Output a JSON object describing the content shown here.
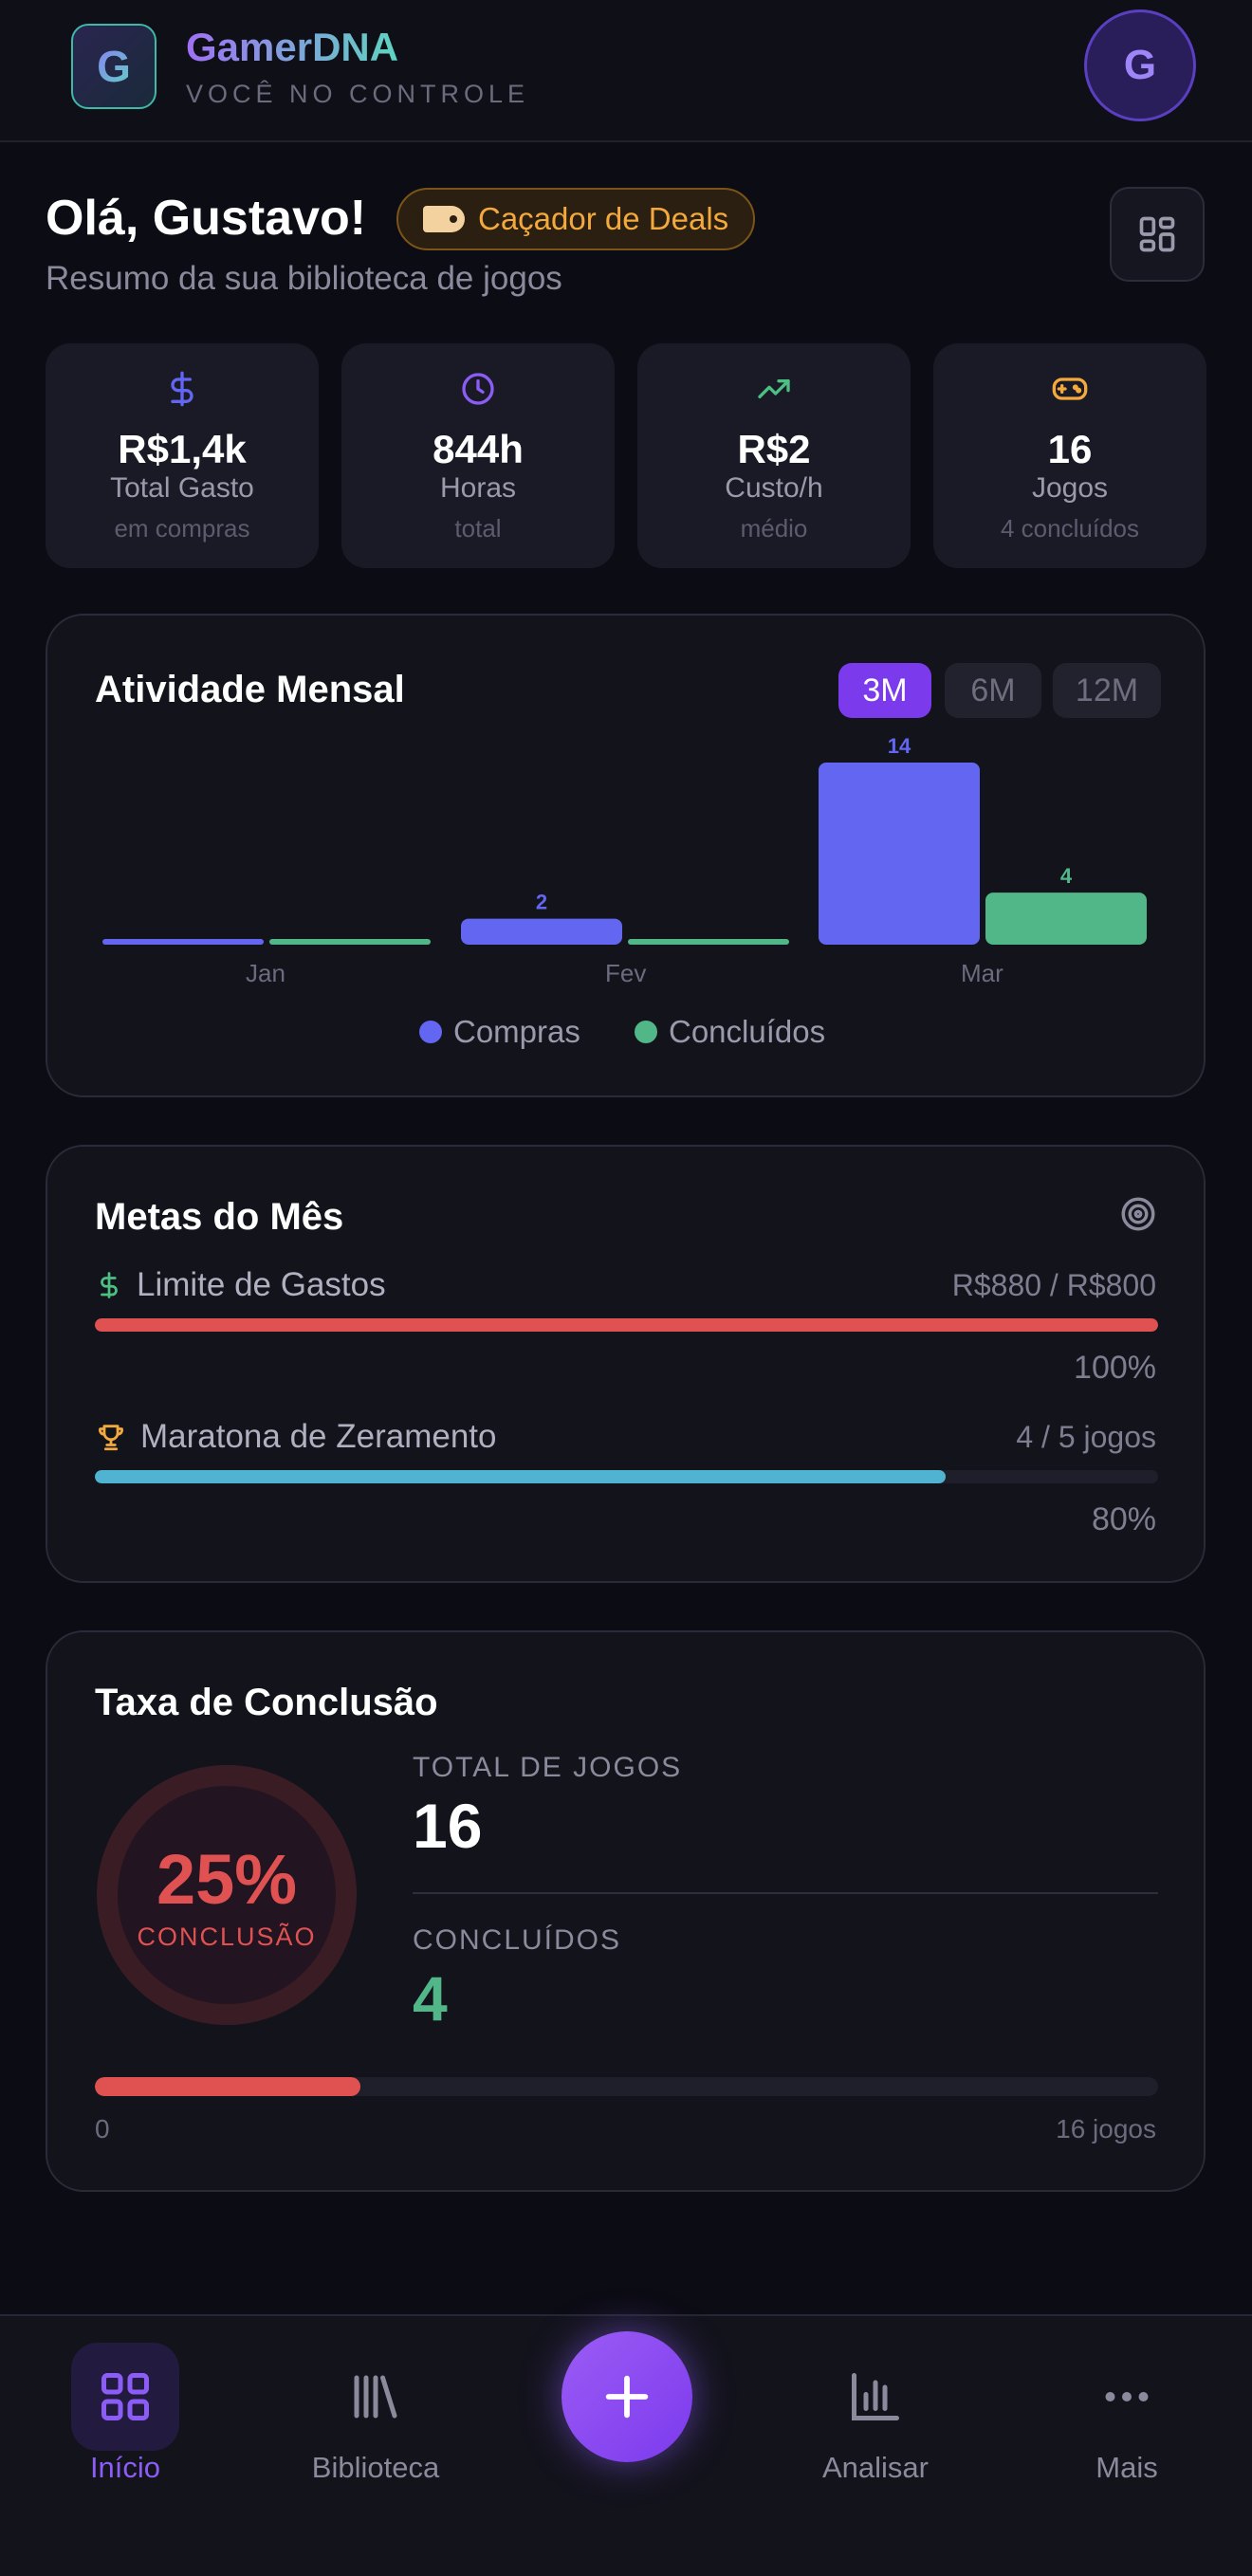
{
  "header": {
    "logo_letter": "G",
    "app_name": "GamerDNA",
    "tagline": "VOCÊ NO CONTROLE",
    "avatar_letter": "G"
  },
  "greeting": {
    "title": "Olá, Gustavo!",
    "badge": "Caçador de Deals",
    "subtitle": "Resumo da sua biblioteca de jogos"
  },
  "stats": [
    {
      "icon": "dollar-icon",
      "value": "R$1,4k",
      "label": "Total Gasto",
      "sub": "em compras",
      "color": "#6366f1"
    },
    {
      "icon": "clock-icon",
      "value": "844h",
      "label": "Horas",
      "sub": "total",
      "color": "#8b5cf6"
    },
    {
      "icon": "trending-up-icon",
      "value": "R$2",
      "label": "Custo/h",
      "sub": "médio",
      "color": "#4cbf83"
    },
    {
      "icon": "gamepad-icon",
      "value": "16",
      "label": "Jogos",
      "sub": "4 concluídos",
      "color": "#f3a93c"
    }
  ],
  "activity": {
    "title": "Atividade Mensal",
    "ranges": [
      "3M",
      "6M",
      "12M"
    ],
    "selected_range": "3M",
    "legend_purchases": "Compras",
    "legend_completed": "Concluídos",
    "colors": {
      "purchases": "#6366f1",
      "completed": "#52b788"
    }
  },
  "chart_data": {
    "type": "bar",
    "categories": [
      "Jan",
      "Fev",
      "Mar"
    ],
    "series": [
      {
        "name": "Compras",
        "values": [
          0,
          2,
          14
        ]
      },
      {
        "name": "Concluídos",
        "values": [
          0,
          0,
          4
        ]
      }
    ],
    "ylim": [
      0,
      14
    ],
    "value_labels": {
      "fev_purchases": "2",
      "mar_purchases": "14",
      "mar_completed": "4"
    }
  },
  "goals": {
    "title": "Metas do Mês",
    "items": [
      {
        "icon": "dollar-icon",
        "label": "Limite de Gastos",
        "value": "R$880 / R$800",
        "percent_label": "100%",
        "progress": 1.0,
        "color": "#e05252"
      },
      {
        "icon": "trophy-icon",
        "label": "Maratona de Zeramento",
        "value": "4 / 5 jogos",
        "percent_label": "80%",
        "progress": 0.8,
        "color": "#4fb3d1"
      }
    ]
  },
  "completion": {
    "title": "Taxa de Conclusão",
    "percent": "25%",
    "percent_caption": "CONCLUSÃO",
    "rate": 0.25,
    "total_label": "TOTAL DE JOGOS",
    "total_value": "16",
    "completed_label": "CONCLUÍDOS",
    "completed_value": "4",
    "scale_min": "0",
    "scale_max": "16 jogos"
  },
  "nav": {
    "home": "Início",
    "library": "Biblioteca",
    "analyze": "Analisar",
    "more": "Mais"
  }
}
